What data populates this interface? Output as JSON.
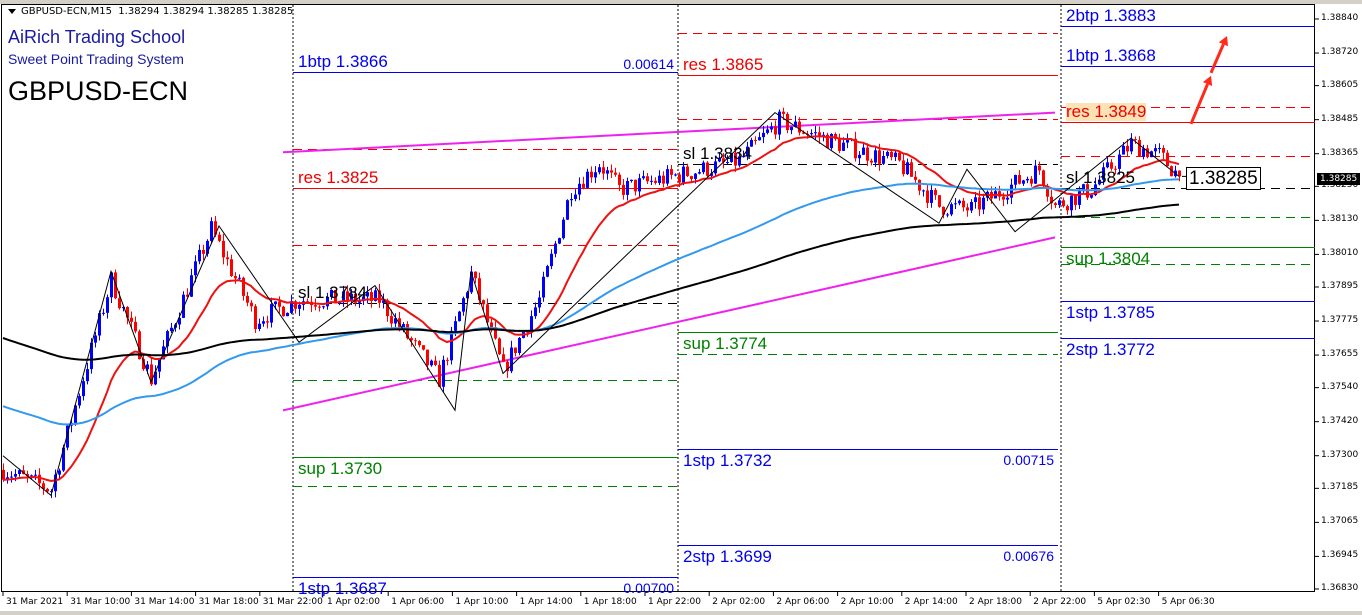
{
  "header": {
    "symbol_tf": "GBPUSD-ECN,M15",
    "ohlc": "1.38294 1.38294 1.38285 1.38285"
  },
  "overlay": {
    "school": "AiRich Trading School",
    "system": "Sweet Point Trading System",
    "symbol": "GBPUSD-ECN"
  },
  "current_price_label": "1.38285",
  "colors": {
    "bull": "#0000ff",
    "bear": "#ff0000",
    "ma_fast": "#ee1111",
    "ma_mid": "#3399ee",
    "ma_slow": "#000000",
    "trendline": "#ee22ee",
    "target": "#0000ee",
    "resistance": "#ee0000",
    "support": "#008000",
    "stop": "#000000"
  },
  "sections": [
    {
      "levels": [
        {
          "price": 1.38653,
          "color": "target",
          "dash": false,
          "label": "1btp 1.3866",
          "side": "above",
          "value": "0.00614"
        },
        {
          "price": 1.38382,
          "color": "resistance",
          "dash": true
        },
        {
          "price": 1.38244,
          "color": "resistance",
          "dash": false,
          "label": "res 1.3825",
          "side": "above"
        },
        {
          "price": 1.38043,
          "color": "resistance",
          "dash": true
        },
        {
          "price": 1.37839,
          "color": "stop",
          "dash": true,
          "label": "sl 1.3784",
          "side": "above"
        },
        {
          "price": 1.37567,
          "color": "support",
          "dash": true
        },
        {
          "price": 1.37296,
          "color": "support",
          "dash": false,
          "label": "sup 1.3730",
          "side": "below"
        },
        {
          "price": 1.37193,
          "color": "support",
          "dash": true
        },
        {
          "price": 1.36872,
          "color": "target",
          "dash": false,
          "label": "1stp 1.3687",
          "side": "below",
          "value": "0.00700"
        }
      ]
    },
    {
      "levels": [
        {
          "price": 1.38791,
          "color": "resistance",
          "dash": true
        },
        {
          "price": 1.38643,
          "color": "resistance",
          "dash": false,
          "label": "res 1.3865",
          "side": "above"
        },
        {
          "price": 1.38487,
          "color": "resistance",
          "dash": true
        },
        {
          "price": 1.38329,
          "color": "stop",
          "dash": true,
          "label": "sl 1.3834",
          "side": "above"
        },
        {
          "price": 1.37736,
          "color": "support",
          "dash": false,
          "label": "sup 1.3774",
          "side": "below"
        },
        {
          "price": 1.37659,
          "color": "support",
          "dash": true
        },
        {
          "price": 1.37324,
          "color": "target",
          "dash": false,
          "label": "1stp 1.3732",
          "side": "below",
          "value": "0.00715"
        },
        {
          "price": 1.36985,
          "color": "target",
          "dash": false,
          "label": "2stp 1.3699",
          "side": "below",
          "value": "0.00676"
        }
      ]
    },
    {
      "levels": [
        {
          "price": 1.38815,
          "color": "target",
          "dash": false,
          "label": "2btp 1.3883",
          "side": "above"
        },
        {
          "price": 1.38674,
          "color": "target",
          "dash": false,
          "label": "1btp 1.3868",
          "side": "above"
        },
        {
          "price": 1.3853,
          "color": "resistance",
          "dash": true
        },
        {
          "price": 1.38477,
          "color": "resistance",
          "dash": false,
          "label": "res 1.3849",
          "side": "above",
          "highlight": true
        },
        {
          "price": 1.38357,
          "color": "resistance",
          "dash": true
        },
        {
          "price": 1.38244,
          "color": "stop",
          "dash": true,
          "label": "sl 1.3825",
          "side": "above"
        },
        {
          "price": 1.38142,
          "color": "support",
          "dash": true
        },
        {
          "price": 1.38036,
          "color": "support",
          "dash": false,
          "label": "sup 1.3804",
          "side": "below"
        },
        {
          "price": 1.37976,
          "color": "support",
          "dash": true
        },
        {
          "price": 1.37846,
          "color": "target",
          "dash": false,
          "label": "1stp 1.3785",
          "side": "below"
        },
        {
          "price": 1.37715,
          "color": "target",
          "dash": false,
          "label": "2stp 1.3772",
          "side": "below"
        }
      ]
    }
  ],
  "chart_data": {
    "type": "candlestick",
    "symbol": "GBPUSD-ECN",
    "timeframe": "M15",
    "ylim": [
      1.3683,
      1.3884
    ],
    "y_ticks": [
      "1.38840",
      "1.38720",
      "1.38605",
      "1.38485",
      "1.38365",
      "1.38250",
      "1.38130",
      "1.38010",
      "1.37895",
      "1.37775",
      "1.37655",
      "1.37540",
      "1.37420",
      "1.37300",
      "1.37185",
      "1.37065",
      "1.36945",
      "1.36830"
    ],
    "x_ticks": [
      "31 Mar 2021",
      "31 Mar 10:00",
      "31 Mar 14:00",
      "31 Mar 18:00",
      "31 Mar 22:00",
      "1 Apr 02:00",
      "1 Apr 06:00",
      "1 Apr 10:00",
      "1 Apr 14:00",
      "1 Apr 18:00",
      "1 Apr 22:00",
      "2 Apr 02:00",
      "2 Apr 06:00",
      "2 Apr 10:00",
      "2 Apr 14:00",
      "2 Apr 18:00",
      "2 Apr 22:00",
      "5 Apr 02:30",
      "5 Apr 06:30"
    ],
    "last_price": 1.38285,
    "close_path": [
      [
        "31 Mar 06:00",
        1.3725
      ],
      [
        "31 Mar 09:00",
        1.3718
      ],
      [
        "31 Mar 12:45",
        1.3792
      ],
      [
        "31 Mar 15:15",
        1.3757
      ],
      [
        "31 Mar 19:00",
        1.381
      ],
      [
        "31 Mar 21:45",
        1.3778
      ],
      [
        "1 Apr 00:30",
        1.3785
      ],
      [
        "1 Apr 05:30",
        1.3785
      ],
      [
        "1 Apr 09:15",
        1.3757
      ],
      [
        "1 Apr 11:15",
        1.3794
      ],
      [
        "1 Apr 13:15",
        1.376
      ],
      [
        "1 Apr 15:30",
        1.3785
      ],
      [
        "1 Apr 17:30",
        1.3824
      ],
      [
        "1 Apr 19:15",
        1.3833
      ],
      [
        "1 Apr 20:30",
        1.3824
      ],
      [
        "2 Apr 00:15",
        1.3829
      ],
      [
        "2 Apr 04:00",
        1.3834
      ],
      [
        "2 Apr 06:30",
        1.3848
      ],
      [
        "2 Apr 10:15",
        1.384
      ],
      [
        "2 Apr 14:00",
        1.3833
      ],
      [
        "2 Apr 16:30",
        1.3818
      ],
      [
        "2 Apr 18:30",
        1.3817
      ],
      [
        "2 Apr 22:45",
        1.3831
      ],
      [
        "5 Apr 00:00",
        1.3818
      ],
      [
        "5 Apr 02:15",
        1.3824
      ],
      [
        "5 Apr 04:45",
        1.384
      ],
      [
        "5 Apr 06:30",
        1.3836
      ],
      [
        "5 Apr 07:45",
        1.38285
      ]
    ],
    "zigzag": [
      [
        "31 Mar 06:00",
        1.373
      ],
      [
        "31 Mar 09:00",
        1.3716
      ],
      [
        "31 Mar 12:45",
        1.3795
      ],
      [
        "31 Mar 15:15",
        1.3756
      ],
      [
        "31 Mar 19:30",
        1.3811
      ],
      [
        "1 Apr 00:30",
        1.377
      ],
      [
        "1 Apr 05:15",
        1.379
      ],
      [
        "1 Apr 10:15",
        1.3746
      ],
      [
        "1 Apr 11:15",
        1.3795
      ],
      [
        "1 Apr 13:15",
        1.3759
      ],
      [
        "2 Apr 06:15",
        1.3851
      ],
      [
        "2 Apr 16:30",
        1.3812
      ],
      [
        "2 Apr 18:15",
        1.3831
      ],
      [
        "2 Apr 21:15",
        1.3809
      ],
      [
        "5 Apr 04:45",
        1.3842
      ],
      [
        "5 Apr 07:45",
        1.38285
      ]
    ],
    "trendlines": [
      {
        "from": [
          "31 Mar 23:30",
          1.3837
        ],
        "to": [
          "5 Apr 00:00",
          1.3851
        ]
      },
      {
        "from": [
          "31 Mar 23:30",
          1.3746
        ],
        "to": [
          "5 Apr 00:00",
          1.3807
        ]
      }
    ],
    "arrows": [
      {
        "from": [
          "5 Apr 08:30",
          1.3847
        ],
        "to": [
          "5 Apr 09:45",
          1.3864
        ]
      },
      {
        "from": [
          "5 Apr 09:45",
          1.3865
        ],
        "to": [
          "5 Apr 10:45",
          1.3878
        ]
      }
    ],
    "moving_averages": [
      "fast",
      "mid",
      "slow"
    ]
  }
}
